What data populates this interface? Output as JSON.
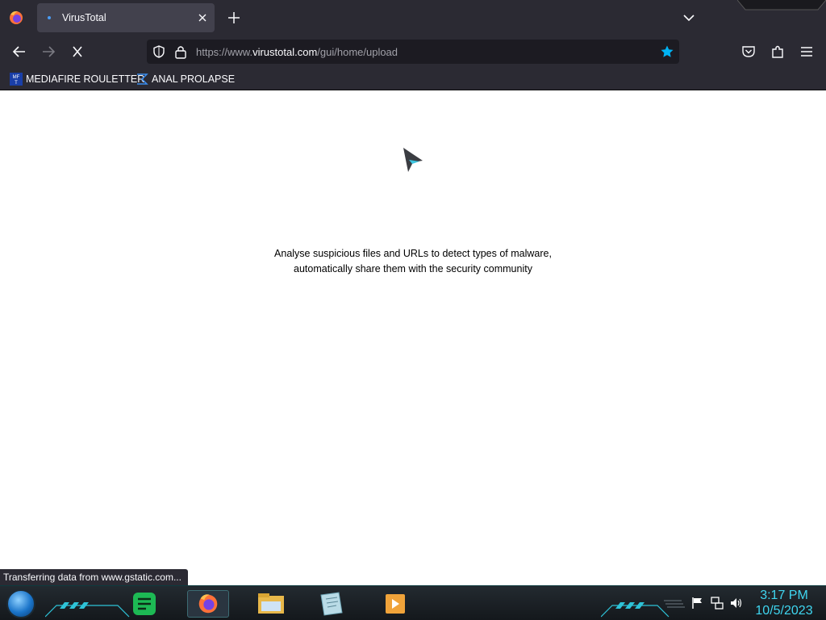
{
  "browser": {
    "tab": {
      "title": "VirusTotal"
    },
    "address": {
      "prefix": "https://www.",
      "host": "virustotal.com",
      "path": "/gui/home/upload"
    },
    "bookmarks": [
      {
        "label": "MEDIAFIRE ROULETTER",
        "icon_text": "MF T"
      },
      {
        "label": "ANAL PROLAPSE",
        "icon": "sigma-icon"
      }
    ],
    "status_text": "Transferring data from www.gstatic.com..."
  },
  "page": {
    "tagline_line1": "Analyse suspicious files and URLs to detect types of malware,",
    "tagline_line2": "automatically share them with the security community"
  },
  "taskbar": {
    "apps": [
      "notes-icon",
      "firefox-icon",
      "file-explorer-icon",
      "notepad-icon",
      "media-player-icon"
    ],
    "clock": {
      "time": "3:17 PM",
      "date": "10/5/2023"
    }
  },
  "colors": {
    "chrome_bg": "#2b2a33",
    "tab_active": "#42414d",
    "url_bg": "#1c1b22",
    "star": "#00b3f4",
    "clock": "#3fd6f0"
  }
}
